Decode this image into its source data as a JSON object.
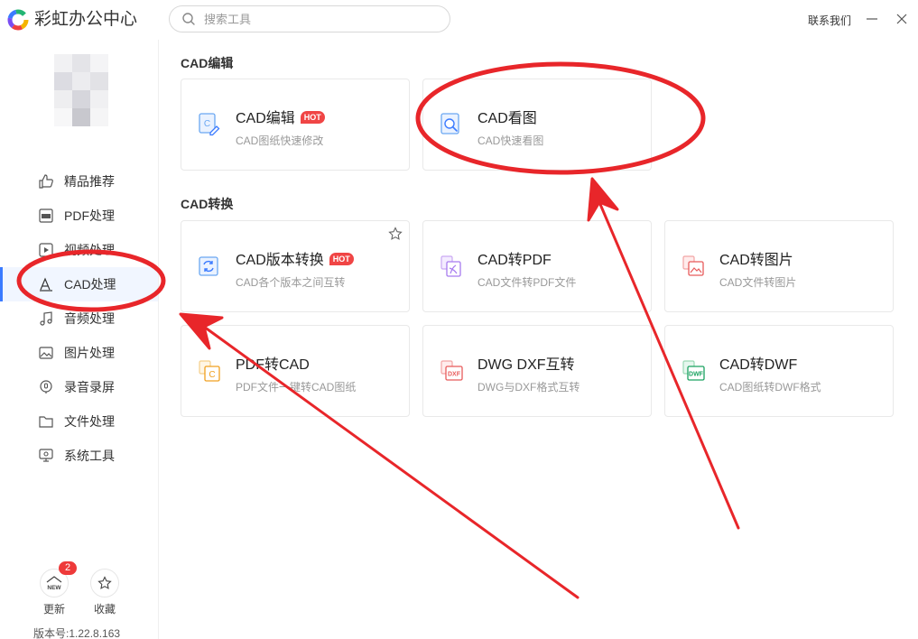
{
  "app": {
    "title": "彩虹办公中心",
    "contact_label": "联系我们"
  },
  "search": {
    "placeholder": "搜索工具"
  },
  "sidebar": {
    "items": [
      {
        "label": "精品推荐",
        "icon": "thumbs-up-icon"
      },
      {
        "label": "PDF处理",
        "icon": "pdf-icon"
      },
      {
        "label": "视频处理",
        "icon": "video-icon"
      },
      {
        "label": "CAD处理",
        "icon": "cad-icon",
        "active": true
      },
      {
        "label": "音频处理",
        "icon": "music-icon"
      },
      {
        "label": "图片处理",
        "icon": "image-icon"
      },
      {
        "label": "录音录屏",
        "icon": "record-icon"
      },
      {
        "label": "文件处理",
        "icon": "folder-icon"
      },
      {
        "label": "系统工具",
        "icon": "system-tool-icon"
      }
    ],
    "update": {
      "label": "更新",
      "badge": "2",
      "icon_text": "NEW"
    },
    "favorites": {
      "label": "收藏"
    },
    "version": "版本号:1.22.8.163"
  },
  "sections": [
    {
      "title": "CAD编辑",
      "cards": [
        {
          "title": "CAD编辑",
          "desc": "CAD图纸快速修改",
          "hot": "HOT",
          "icon": "cad-edit-icon"
        },
        {
          "title": "CAD看图",
          "desc": "CAD快速看图",
          "icon": "cad-view-icon"
        }
      ]
    },
    {
      "title": "CAD转换",
      "cards": [
        {
          "title": "CAD版本转换",
          "desc": "CAD各个版本之间互转",
          "hot": "HOT",
          "icon": "cad-version-icon"
        },
        {
          "title": "CAD转PDF",
          "desc": "CAD文件转PDF文件",
          "icon": "cad-to-pdf-icon"
        },
        {
          "title": "CAD转图片",
          "desc": "CAD文件转图片",
          "icon": "cad-to-image-icon"
        },
        {
          "title": "PDF转CAD",
          "desc": "PDF文件一键转CAD图纸",
          "icon": "pdf-to-cad-icon"
        },
        {
          "title": "DWG DXF互转",
          "desc": "DWG与DXF格式互转",
          "icon": "dwg-dxf-icon",
          "icon_text": "DXF"
        },
        {
          "title": "CAD转DWF",
          "desc": "CAD图纸转DWF格式",
          "icon": "cad-to-dwf-icon",
          "icon_text": "DWF"
        }
      ]
    }
  ],
  "colors": {
    "accent": "#3b7bff",
    "hot": "#f04545",
    "annotation": "#e8262a"
  }
}
